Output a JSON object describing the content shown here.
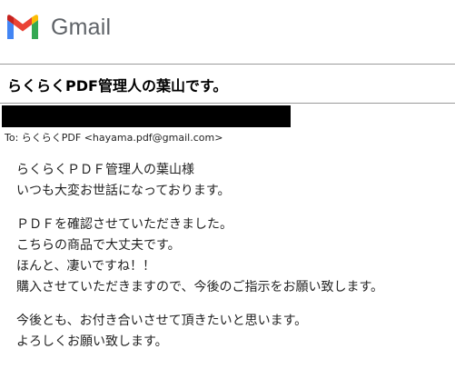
{
  "app": {
    "name": "Gmail",
    "logo_icon": "gmail-m-logo-icon",
    "logo_colors": {
      "blue": "#4285F4",
      "red": "#EA4335",
      "yellow": "#FBBC04",
      "green": "#34A853",
      "dark_red": "#C5221F"
    }
  },
  "email": {
    "subject": "らくらくPDF管理人の葉山です。",
    "to": "To: らくらくPDF <hayama.pdf@gmail.com>",
    "paragraphs": [
      [
        "らくらくＰＤＦ管理人の葉山様",
        "いつも大変お世話になっております。"
      ],
      [
        "ＰＤＦを確認させていただきました。",
        "こちらの商品で大丈夫です。",
        "ほんと、凄いですね！！",
        "購入させていただきますので、今後のご指示をお願い致します。"
      ],
      [
        "今後とも、お付き合いさせて頂きたいと思います。",
        "よろしくお願い致します。"
      ]
    ]
  }
}
